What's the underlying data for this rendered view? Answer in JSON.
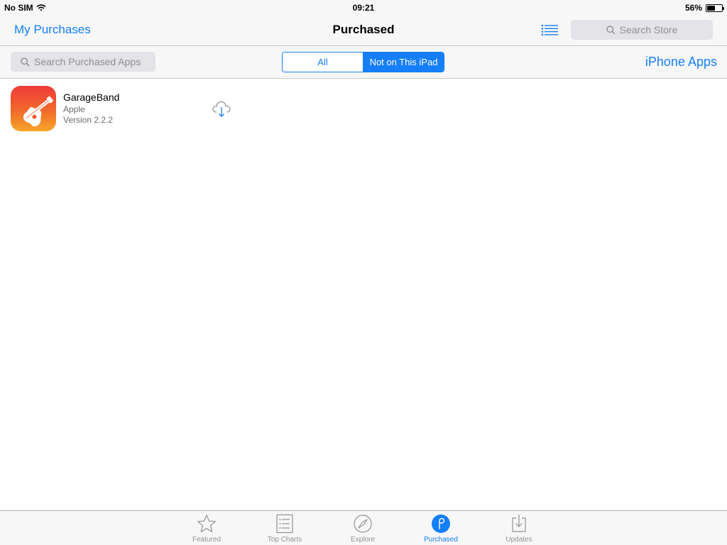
{
  "status_bar": {
    "carrier": "No SIM",
    "time": "09:21",
    "battery": "56%",
    "battery_level": 0.56
  },
  "nav_bar": {
    "back_label": "My Purchases",
    "title": "Purchased",
    "store_search_placeholder": "Search Store"
  },
  "toolbar": {
    "purchased_search_placeholder": "Search Purchased Apps",
    "segments": [
      {
        "label": "All",
        "selected": false
      },
      {
        "label": "Not on This iPad",
        "selected": true
      }
    ],
    "device_filter_label": "iPhone Apps"
  },
  "apps": [
    {
      "name": "GarageBand",
      "developer": "Apple",
      "version": "Version 2.2.2",
      "icon": "guitar-icon"
    }
  ],
  "tab_bar": {
    "tabs": [
      {
        "label": "Featured",
        "icon": "star-icon",
        "active": false
      },
      {
        "label": "Top Charts",
        "icon": "list-icon",
        "active": false
      },
      {
        "label": "Explore",
        "icon": "compass-icon",
        "active": false
      },
      {
        "label": "Purchased",
        "icon": "purchased-icon",
        "active": true
      },
      {
        "label": "Updates",
        "icon": "download-tray-icon",
        "active": false
      }
    ]
  },
  "colors": {
    "accent": "#157efb",
    "bar_background": "#f7f7f7",
    "inactive_tab": "#929292",
    "search_field": "#e3e3e8"
  }
}
